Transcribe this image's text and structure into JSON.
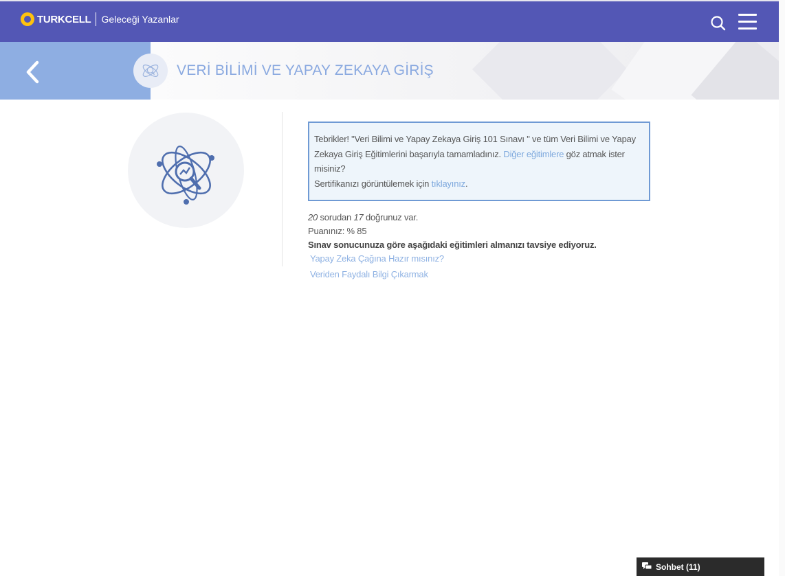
{
  "header": {
    "brand": "TURKCELL",
    "tagline": "Geleceği Yazanlar",
    "search_icon": "search-icon",
    "menu_icon": "hamburger-menu-icon"
  },
  "banner": {
    "back_icon": "chevron-left-icon",
    "course_icon": "atom-search-icon",
    "title": "VERİ BİLİMİ VE YAPAY ZEKAYA GİRİŞ"
  },
  "notice": {
    "line1": "Tebrikler! \"Veri Bilimi ve Yapay Zekaya Giriş 101 Sınavı \" ve tüm Veri Bilimi ve Yapay Zekaya Giriş Eğitimlerini başarıyla tamamladınız.",
    "other_trainings_link": "Diğer eğitimlere",
    "line1_tail": "göz atmak ister misiniz?",
    "cert_text": "Sertifikanızı görüntülemek için",
    "cert_link": "tıklayınız",
    "cert_tail": "."
  },
  "result": {
    "total": "20",
    "sorudan": "sorudan",
    "correct": "17",
    "correct_tail": "doğrunuz var.",
    "score_label": "Puanınız: % 85",
    "recommend": "Sınav sonucunuza göre aşağıdaki eğitimleri almanızı tavsiye ediyoruz.",
    "recommendations": [
      "Yapay Zeka Çağına Hazır mısınız?",
      "Veriden Faydalı Bilgi Çıkarmak"
    ]
  },
  "chat": {
    "label": "Sohbet (11)",
    "icon": "chat-bubbles-icon"
  },
  "colors": {
    "header_bg": "#5357b5",
    "back_bg": "#8eaee2",
    "title": "#8aa9e0",
    "link": "#7da8dd",
    "notice_border": "#6f9ad4"
  }
}
